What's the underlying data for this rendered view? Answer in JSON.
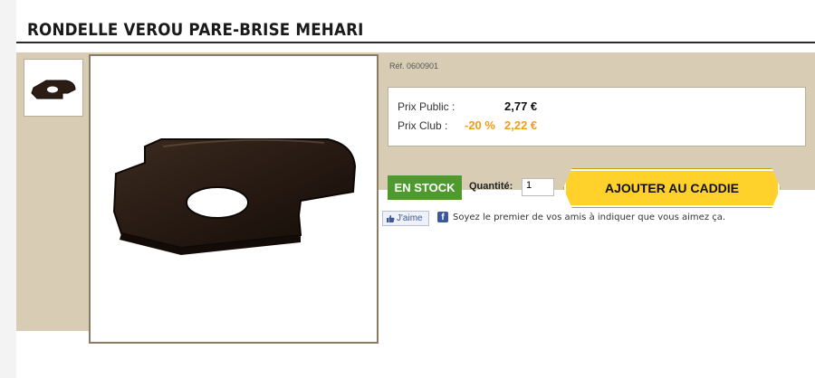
{
  "product": {
    "title": "RONDELLE VEROU PARE-BRISE MEHARI",
    "reference": "Réf. 0600901"
  },
  "prices": {
    "public_label": "Prix Public :",
    "public_value": "2,77 €",
    "club_label": "Prix Club :",
    "club_discount": "-20 %",
    "club_value": "2,22 €"
  },
  "stock": {
    "label": "EN STOCK"
  },
  "quantity": {
    "label": "Quantité:",
    "value": "1"
  },
  "cart": {
    "button_label": "AJOUTER AU CADDIE"
  },
  "social": {
    "like_label": "J'aime",
    "fb_glyph": "f",
    "like_text": "Soyez le premier de vos amis à indiquer que vous aimez ça."
  },
  "colors": {
    "band": "#d8cdb4",
    "stock_green": "#4e9a2f",
    "club_orange": "#f39c12",
    "cart_yellow": "#ffd12a"
  }
}
